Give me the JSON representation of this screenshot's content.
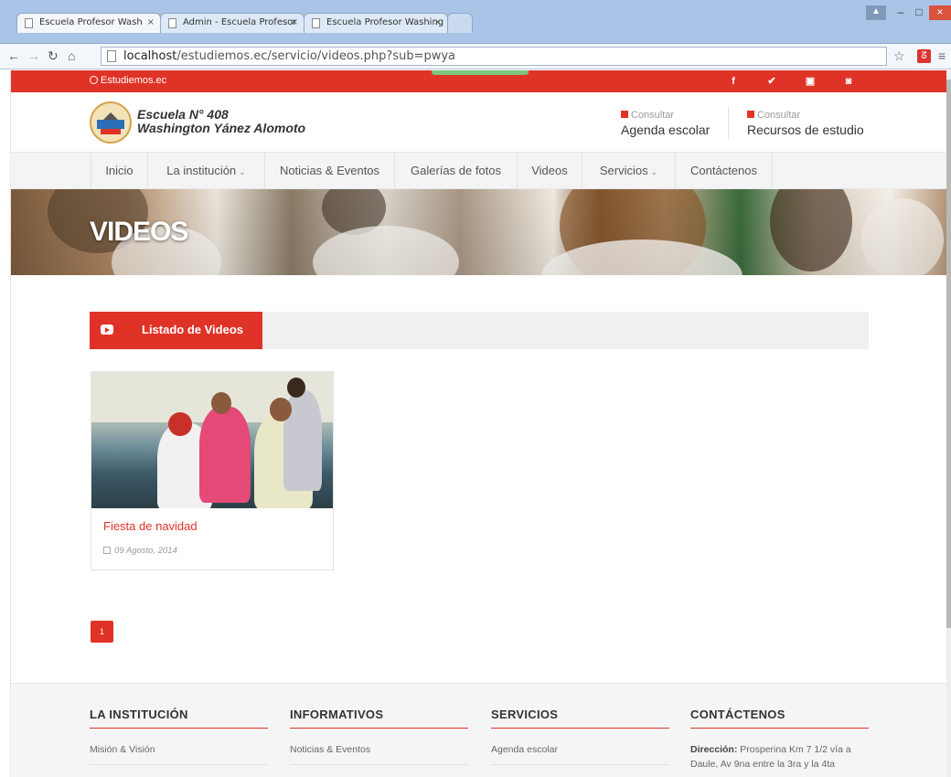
{
  "browser": {
    "tabs": [
      {
        "title": "Escuela Profesor Wash",
        "active": true
      },
      {
        "title": "Admin - Escuela Profesor",
        "active": false
      },
      {
        "title": "Escuela Profesor Washing",
        "active": false
      }
    ],
    "url_host": "localhost",
    "url_path": "/estudiemos.ec/servicio/videos.php?sub=pwya"
  },
  "topbar": {
    "brand": "Estudiemos.ec",
    "social": [
      "f",
      "t",
      "yt",
      "ig"
    ]
  },
  "header": {
    "school_line1": "Escuela N° 408",
    "school_line2": "Washington Yánez Alomoto",
    "link1_small": "Consultar",
    "link1_big": "Agenda escolar",
    "link2_small": "Consultar",
    "link2_big": "Recursos de estudio"
  },
  "nav": {
    "items": [
      "Inicio",
      "La institución",
      "Noticias & Eventos",
      "Galerías de fotos",
      "Videos",
      "Servicios",
      "Contáctenos"
    ]
  },
  "banner": {
    "title": "VIDEOS"
  },
  "section": {
    "title": "Listado de Videos"
  },
  "videos": [
    {
      "title": "Fiesta de navidad",
      "date": "09 Agosto, 2014"
    }
  ],
  "pagination": {
    "current": "1"
  },
  "footer": {
    "col1_title": "LA INSTITUCIÓN",
    "col1_item": "Misión & Visión",
    "col2_title": "INFORMATIVOS",
    "col2_item": "Noticias & Eventos",
    "col3_title": "SERVICIOS",
    "col3_item": "Agenda escolar",
    "col4_title": "CONTÁCTENOS",
    "col4_label": "Dirección:",
    "col4_text": "Prosperina Km 7 1/2 vía a Daule, Av 9na entre la 3ra y la 4ta"
  },
  "colors": {
    "accent": "#e03327",
    "nav_bg": "#f4f4f4",
    "footer_bg": "#f5f5f5"
  }
}
